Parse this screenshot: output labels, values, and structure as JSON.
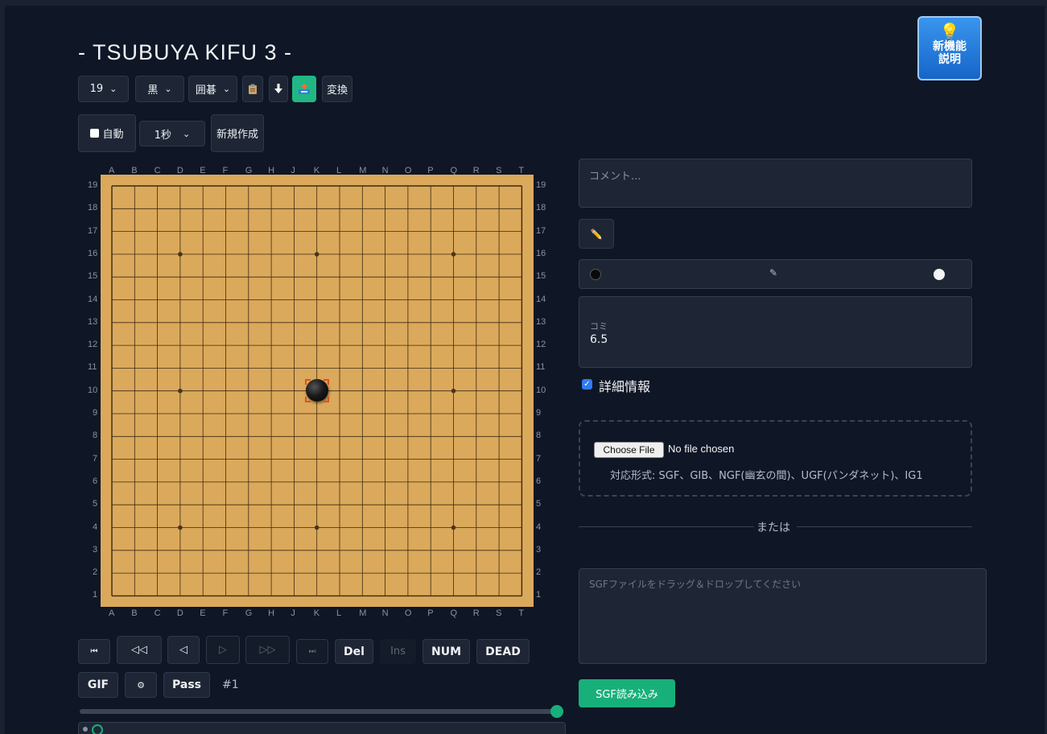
{
  "title": "- TSUBUYA KIFU 3 -",
  "new_feature_button": {
    "line1": "新機能",
    "line2": "説明"
  },
  "toolbar": {
    "size_select": "19",
    "color_select": "黒",
    "game_select": "囲碁",
    "convert_label": "変換",
    "auto_label": "自動",
    "interval_select": "1秒",
    "new_label": "新規作成"
  },
  "board": {
    "size": 19,
    "col_labels": [
      "A",
      "B",
      "C",
      "D",
      "E",
      "F",
      "G",
      "H",
      "J",
      "K",
      "L",
      "M",
      "N",
      "O",
      "P",
      "Q",
      "R",
      "S",
      "T"
    ],
    "row_labels": [
      "19",
      "18",
      "17",
      "16",
      "15",
      "14",
      "13",
      "12",
      "11",
      "10",
      "9",
      "8",
      "7",
      "6",
      "5",
      "4",
      "3",
      "2",
      "1"
    ],
    "stones": [
      {
        "color": "black",
        "point": "K10",
        "last_move": true
      }
    ],
    "colors": {
      "wood": "#dba95b",
      "line": "#3b2a12"
    }
  },
  "controls": {
    "first": "⏮",
    "back_many": "◁◁",
    "back": "◁",
    "forward": "▷",
    "forward_many": "▷▷",
    "last": "⏭",
    "del": "Del",
    "ins": "Ins",
    "num": "NUM",
    "dead": "DEAD",
    "gif": "GIF",
    "settings": "⚙",
    "pass": "Pass",
    "move_number": "#1"
  },
  "right": {
    "comment_placeholder": "コメント...",
    "edit_icon": "✏️",
    "players_edit_icon": "✎",
    "komi_label": "コミ",
    "komi_value": "6.5",
    "details_label": "詳細情報",
    "choose_file": "Choose File",
    "no_file": "No file chosen",
    "formats": "対応形式: SGF、GIB、NGF(幽玄の間)、UGF(パンダネット)、IG1",
    "or_label": "または",
    "sgf_placeholder": "SGFファイルをドラッグ＆ドロップしてください",
    "load_button": "SGF読み込み"
  },
  "accent": "#18b07a"
}
